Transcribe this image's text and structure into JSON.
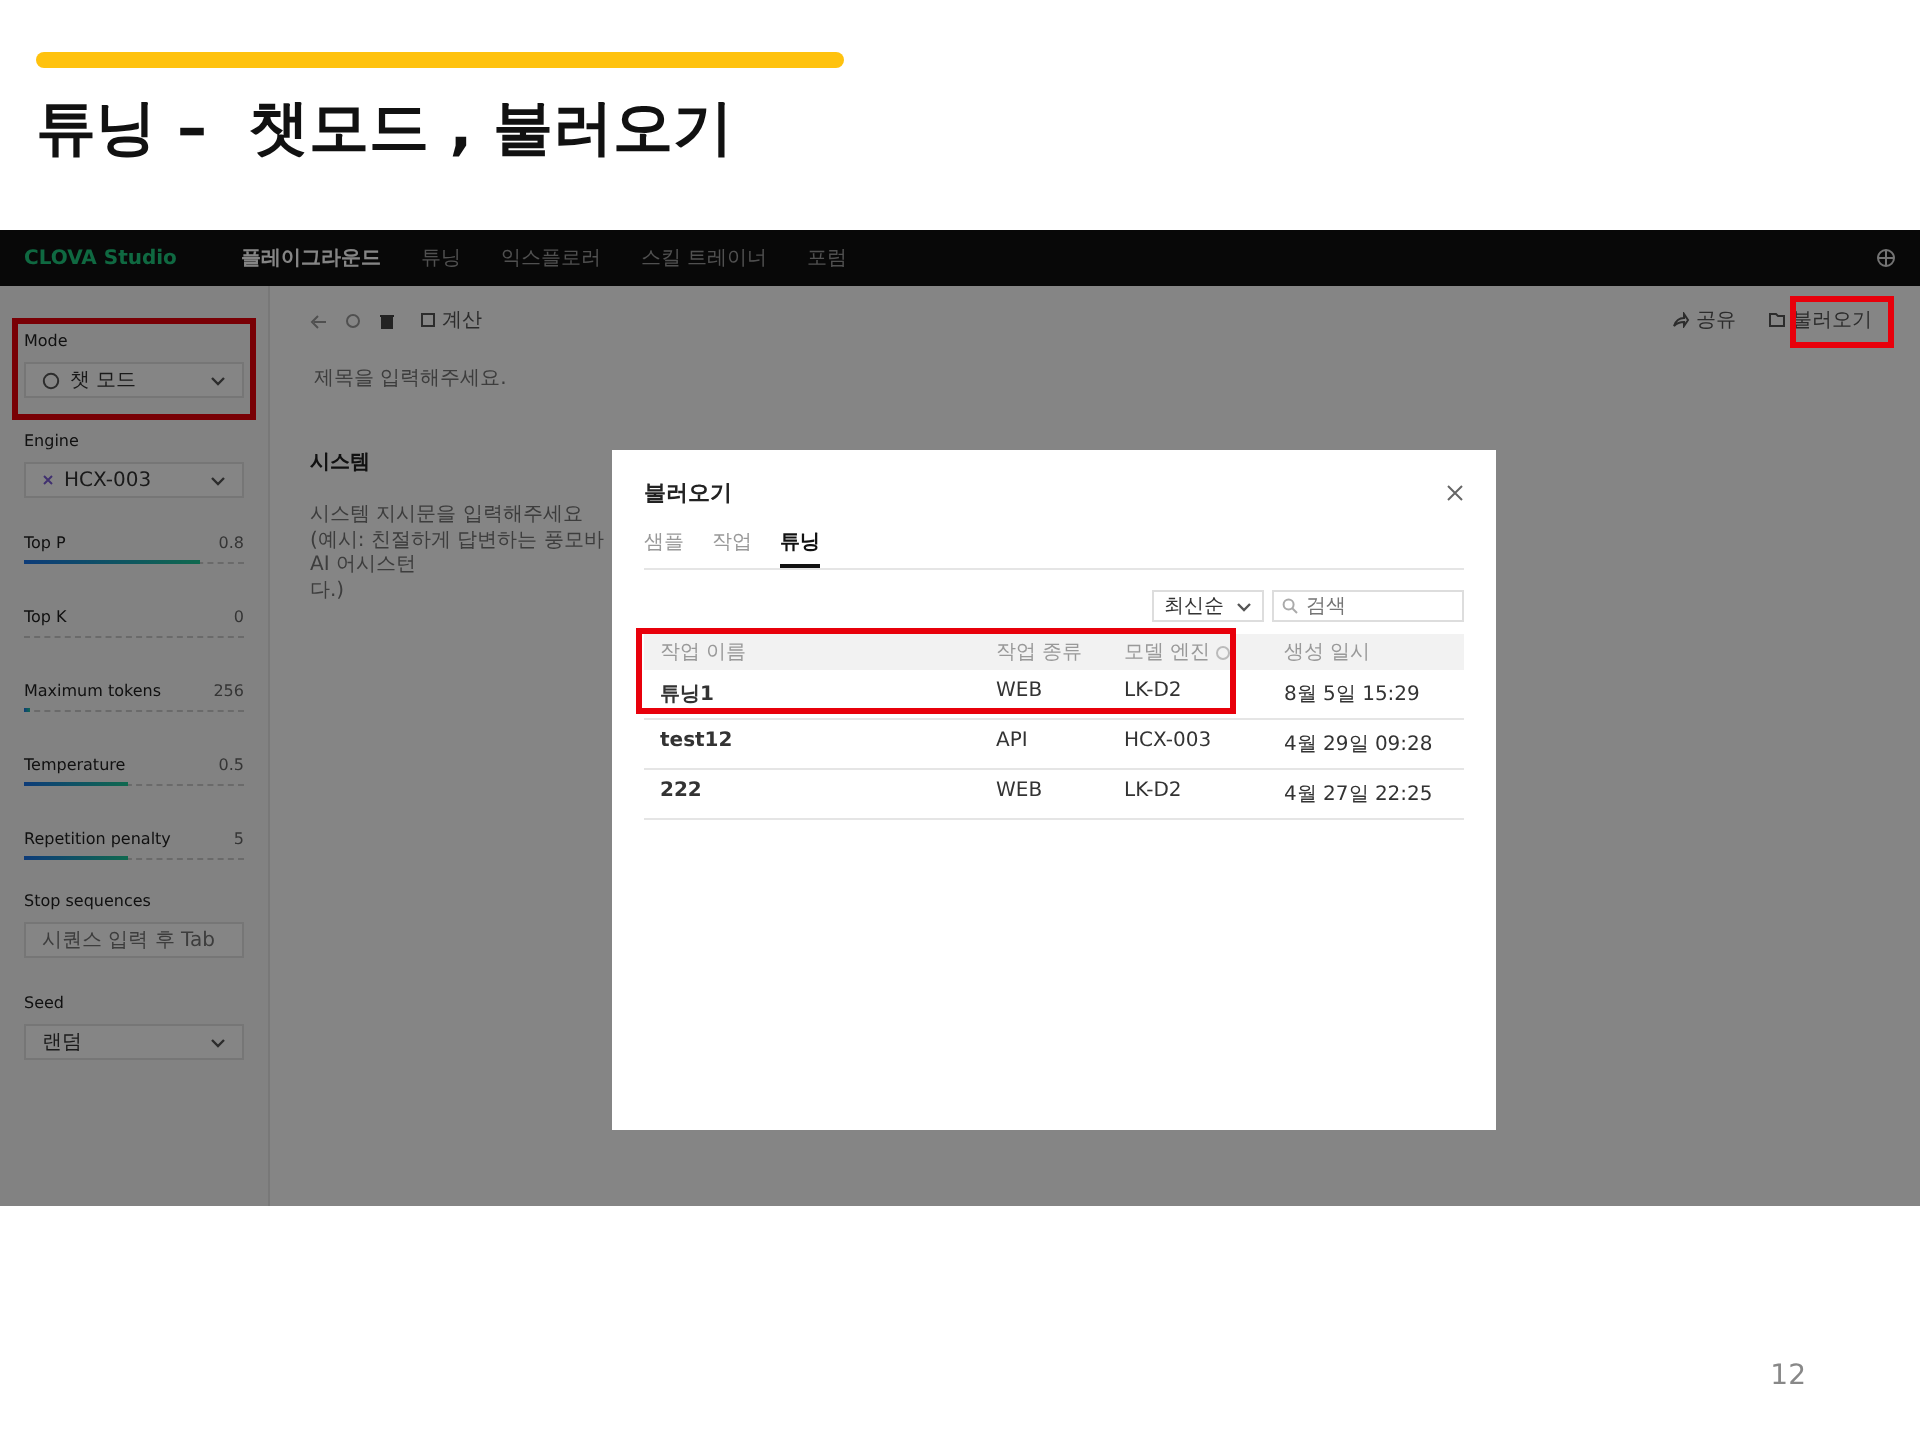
{
  "slide": {
    "title": "튜닝 –  챗모드 , 불러오기",
    "page_number": "12"
  },
  "app": {
    "nav": {
      "logo": "CLOVA Studio",
      "items": [
        {
          "label": "플레이그라운드",
          "selected": true
        },
        {
          "label": "튜닝",
          "selected": false
        },
        {
          "label": "익스플로러",
          "selected": false
        },
        {
          "label": "스킬 트레이너",
          "selected": false
        },
        {
          "label": "포럼",
          "selected": false
        }
      ]
    },
    "sidebar": {
      "mode": {
        "label": "Mode",
        "value": "챗 모드"
      },
      "engine": {
        "label": "Engine",
        "value": "HCX-003"
      },
      "sliders": [
        {
          "label": "Top P",
          "reading": "0.8",
          "level": 0.8
        },
        {
          "label": "Top K",
          "reading": "0",
          "level": 0
        },
        {
          "label": "Maximum tokens",
          "reading": "256",
          "level": 0.03
        },
        {
          "label": "Temperature",
          "reading": "0.5",
          "level": 0.47
        },
        {
          "label": "Repetition penalty",
          "reading": "5",
          "level": 0.47
        }
      ],
      "stop_sequences": {
        "label": "Stop sequences",
        "placeholder": "시퀀스 입력 후 Tab"
      },
      "seed": {
        "label": "Seed",
        "value": "랜덤"
      }
    },
    "toolbar": {
      "calc_label": "계산",
      "share_label": "공유",
      "load_label": "불러오기"
    },
    "editor": {
      "title_placeholder": "제목을 입력해주세요.",
      "system_heading": "시스템",
      "system_placeholder": "시스템 지시문을 입력해주세요\n(예시: 친절하게 답변하는 풍모바 AI 어시스턴\n다.)"
    },
    "dialog": {
      "title": "불러오기",
      "tabs": [
        {
          "label": "샘플",
          "selected": false
        },
        {
          "label": "작업",
          "selected": false
        },
        {
          "label": "튜닝",
          "selected": true
        }
      ],
      "sort": "최신순",
      "search_placeholder": "검색",
      "columns": [
        "작업 이름",
        "작업 종류",
        "모델 엔진",
        "생성 일시"
      ],
      "rows": [
        {
          "name": "튜닝1",
          "type": "WEB",
          "engine": "LK-D2",
          "created": "8월 5일 15:29"
        },
        {
          "name": "test12",
          "type": "API",
          "engine": "HCX-003",
          "created": "4월 29일 09:28"
        },
        {
          "name": "222",
          "type": "WEB",
          "engine": "LK-D2",
          "created": "4월 27일 22:25"
        }
      ]
    }
  }
}
